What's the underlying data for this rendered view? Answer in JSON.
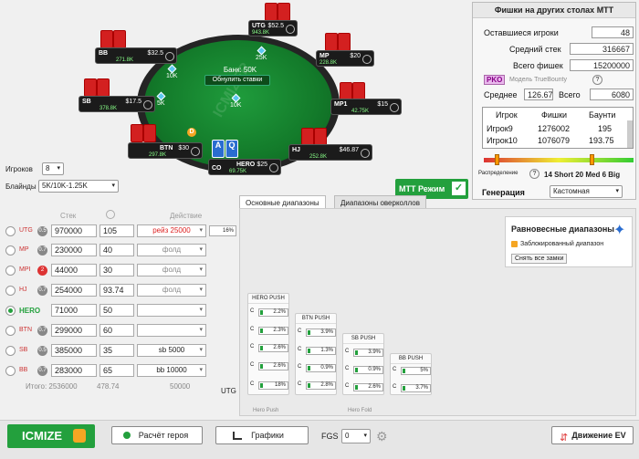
{
  "table": {
    "pot": "Банк: 50K",
    "reset": "Обнулить ставки",
    "watermark": "ICMIZER",
    "chips": [
      "10K",
      "25K",
      "10K",
      "5K"
    ],
    "seats": [
      {
        "name": "UTG",
        "stack": "943.8K",
        "bb": "52.5",
        "amt": "$52.5"
      },
      {
        "name": "MP",
        "stack": "228.8K",
        "bb": "20",
        "amt": "$20"
      },
      {
        "name": "MP1",
        "stack": "42.75K",
        "bb": "4.4",
        "amt": "$15"
      },
      {
        "name": "HJ",
        "stack": "252.8K",
        "bb": "25",
        "amt": "$46.87"
      },
      {
        "name": "HERO",
        "stack": "69.75K",
        "bb": "71",
        "amt": "$25"
      },
      {
        "name": "CO",
        "stack": "",
        "bb": "",
        "amt": ""
      },
      {
        "name": "BTN",
        "stack": "297.8K",
        "bb": "30",
        "amt": "$30"
      },
      {
        "name": "SB",
        "stack": "378.8K",
        "bb": "39",
        "amt": "$17.5"
      },
      {
        "name": "BB",
        "stack": "271.8K",
        "bb": "39",
        "amt": "$32.5"
      }
    ],
    "hero_cards": [
      "A",
      "Q"
    ]
  },
  "left": {
    "players_label": "Игроков",
    "players_value": "8",
    "blinds_label": "Блайнды",
    "blinds_value": "5K/10K-1.25K",
    "col_stack": "Стек",
    "col_action": "Действие",
    "rows": [
      {
        "pos": "UTG",
        "badge": "0.5",
        "stack": "970000",
        "bb": "105",
        "action": "рейз 25000",
        "pct": "16%"
      },
      {
        "pos": "MP",
        "badge": "0.7",
        "stack": "230000",
        "bb": "40",
        "action": "фолд"
      },
      {
        "pos": "MPI",
        "badge": "2",
        "stack": "44000",
        "bb": "30",
        "action": "фолд"
      },
      {
        "pos": "HJ",
        "badge": "0.7",
        "stack": "254000",
        "bb": "93.74",
        "action": "фолд"
      },
      {
        "pos": "HERO",
        "badge": "",
        "stack": "71000",
        "bb": "50",
        "action": ""
      },
      {
        "pos": "BTN",
        "badge": "0.7",
        "stack": "299000",
        "bb": "60",
        "action": ""
      },
      {
        "pos": "SB",
        "badge": "0.5",
        "stack": "385000",
        "bb": "35",
        "action": "sb 5000"
      },
      {
        "pos": "BB",
        "badge": "0.7",
        "stack": "283000",
        "bb": "65",
        "action": "bb 10000"
      }
    ],
    "totals_label": "Итого: 2536000",
    "totals_bb": "478.74",
    "totals_action": "50000",
    "utg_label": "UTG"
  },
  "mtt": {
    "title": "Фишки на других столах MTT",
    "remaining_label": "Оставшиеся игроки",
    "remaining": "48",
    "avg_label": "Средний стек",
    "avg": "316667",
    "total_label": "Всего фишек",
    "total": "15200000",
    "pko": "PKO",
    "model": "Модель TrueBounty",
    "avg2_label": "Среднее",
    "avg2": "126.67",
    "total2_label": "Всего",
    "total2": "6080",
    "cols": [
      "Игрок",
      "Фишки",
      "Баунти"
    ],
    "rows": [
      [
        "Игрок9",
        "1276002",
        "195"
      ],
      [
        "Игрок10",
        "1076079",
        "193.75"
      ]
    ],
    "dist_label": "Распределение",
    "dist_value": "14 Short 20 Med 6 Big",
    "gen_label": "Генерация",
    "gen_value": "Кастомная",
    "mode_label": "MTT Режим"
  },
  "ranges": {
    "tab1": "Основные диапазоны",
    "tab2": "Диапазоны оверколлов",
    "eq_title": "Равновесные диапазоны",
    "locked": "Заблокированный диапазон",
    "unlock": "Снять все замки",
    "boxes": [
      {
        "title": "HERO PUSH",
        "rows": [
          "2.2%",
          "2.3%",
          "2.6%",
          "2.6%",
          "18%"
        ],
        "footer": "Hero Push"
      },
      {
        "title": "BTN PUSH",
        "rows": [
          "3.9%",
          "1.3%",
          "0.9%",
          "2.8%"
        ],
        "footer": "Hero Fold"
      },
      {
        "title": "SB PUSH",
        "rows": [
          "3.9%",
          "0.9%",
          "2.6%"
        ],
        "footer": ""
      },
      {
        "title": "BB PUSH",
        "rows": [
          "5%",
          "3.7%"
        ],
        "footer": ""
      }
    ]
  },
  "bottom": {
    "icmize": "ICMIZE",
    "calc": "Расчёт героя",
    "charts": "Графики",
    "fgs_label": "FGS",
    "fgs_value": "0",
    "ev": "Движение EV"
  }
}
